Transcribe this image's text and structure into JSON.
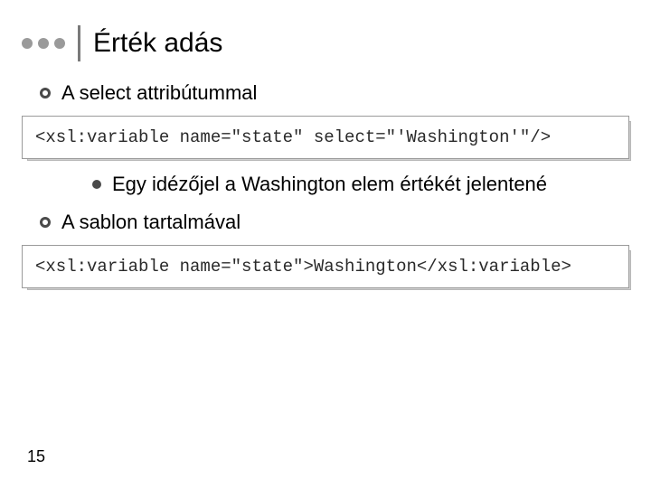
{
  "title": "Érték adás",
  "bullets": {
    "b1": "A select attribútummal",
    "b2": "Egy idézőjel a Washington elem értékét jelentené",
    "b3": "A sablon tartalmával"
  },
  "code": {
    "c1": "<xsl:variable name=\"state\" select=\"'Washington'\"/>",
    "c2": "<xsl:variable name=\"state\">Washington</xsl:variable>"
  },
  "page_number": "15"
}
